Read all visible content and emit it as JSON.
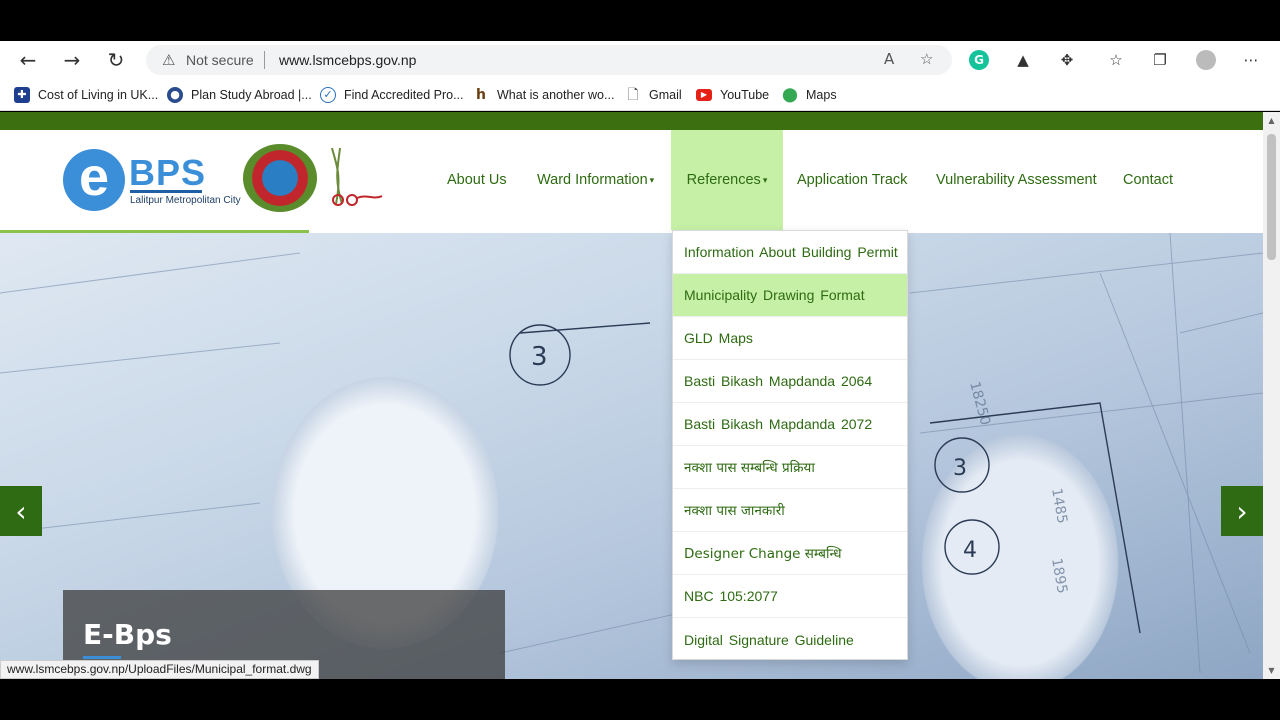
{
  "browser": {
    "address": {
      "security_label": "Not secure",
      "url": "www.lsmcebps.gov.np"
    },
    "bookmarks": [
      {
        "label": "Cost of Living in UK...",
        "icon": "uk-flag-icon"
      },
      {
        "label": "Plan Study Abroad |...",
        "icon": "globe-icon"
      },
      {
        "label": "Find Accredited Pro...",
        "icon": "badge-icon"
      },
      {
        "label": "What is another wo...",
        "icon": "h-icon"
      },
      {
        "label": "Gmail",
        "icon": "document-icon"
      },
      {
        "label": "YouTube",
        "icon": "youtube-icon"
      },
      {
        "label": "Maps",
        "icon": "maps-pin-icon"
      }
    ],
    "status_url": "www.lsmcebps.gov.np/UploadFiles/Municipal_format.dwg"
  },
  "site": {
    "logo": {
      "letter": "e",
      "name": "BPS",
      "subtitle": "Lalitpur Metropolitan City"
    },
    "nav": [
      {
        "label": "About Us"
      },
      {
        "label": "Ward Information",
        "caret": "▾"
      },
      {
        "label": "References",
        "caret": "▾"
      },
      {
        "label": "Application Track"
      },
      {
        "label": "Vulnerability Assessment"
      },
      {
        "label": "Contact"
      }
    ],
    "active_nav": "References",
    "dropdown": [
      "Information About Building Permit",
      "Municipality Drawing Format",
      "GLD Maps",
      "Basti Bikash Mapdanda 2064",
      "Basti Bikash Mapdanda 2072",
      "नक्शा पास सम्बन्धि प्रक्रिया",
      "नक्शा पास जानकारी",
      "Designer Change सम्बन्धि",
      "NBC 105:2077",
      "Digital Signature Guideline"
    ],
    "highlighted_item": "Municipality Drawing Format",
    "slider": {
      "caption": "E-Bps",
      "prev": "‹",
      "next": "›"
    }
  },
  "colors": {
    "brand_green": "#2e6b12",
    "highlight_green": "#c6f0a6",
    "logo_blue": "#3b8fd8"
  }
}
